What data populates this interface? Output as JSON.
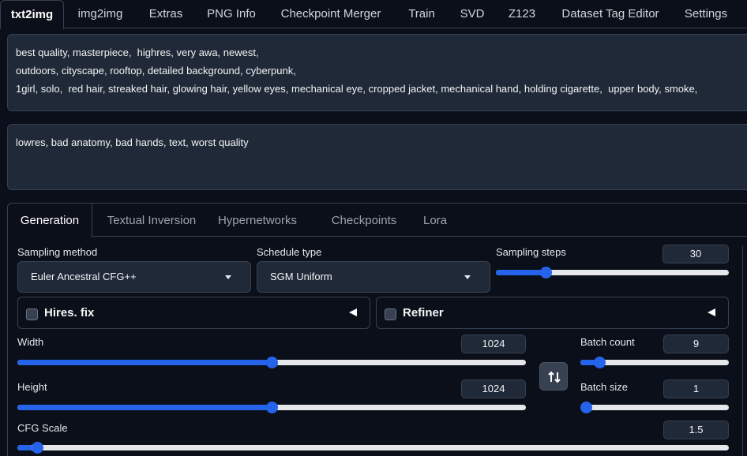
{
  "top_tabs": [
    {
      "label": "txt2img",
      "active": true
    },
    {
      "label": "img2img"
    },
    {
      "label": "Extras"
    },
    {
      "label": "PNG Info"
    },
    {
      "label": "Checkpoint Merger"
    },
    {
      "label": "Train"
    },
    {
      "label": "SVD"
    },
    {
      "label": "Z123"
    },
    {
      "label": "Dataset Tag Editor"
    },
    {
      "label": "Settings"
    }
  ],
  "prompt": {
    "positive": "best quality, masterpiece,  highres, very awa, newest,\noutdoors, cityscape, rooftop, detailed background, cyberpunk,\n1girl, solo,  red hair, streaked hair, glowing hair, yellow eyes, mechanical eye, cropped jacket, mechanical hand, holding cigarette,  upper body, smoke,",
    "negative": "lowres, bad anatomy, bad hands, text, worst quality"
  },
  "sub_tabs": [
    {
      "label": "Generation",
      "active": true
    },
    {
      "label": "Textual Inversion"
    },
    {
      "label": "Hypernetworks"
    },
    {
      "label": "Checkpoints"
    },
    {
      "label": "Lora"
    }
  ],
  "sampling_method": {
    "label": "Sampling method",
    "value": "Euler Ancestral CFG++"
  },
  "schedule_type": {
    "label": "Schedule type",
    "value": "SGM Uniform"
  },
  "sampling_steps": {
    "label": "Sampling steps",
    "value": "30",
    "fraction": 0.2
  },
  "hires_fix": {
    "label": "Hires. fix"
  },
  "refiner": {
    "label": "Refiner"
  },
  "width": {
    "label": "Width",
    "value": "1024",
    "fraction": 0.5
  },
  "height": {
    "label": "Height",
    "value": "1024",
    "fraction": 0.5
  },
  "batch_count": {
    "label": "Batch count",
    "value": "9",
    "fraction": 0.1
  },
  "batch_size": {
    "label": "Batch size",
    "value": "1",
    "fraction": 0.0
  },
  "cfg_scale": {
    "label": "CFG Scale",
    "value": "1.5",
    "fraction": 0.02
  },
  "colors": {
    "accent": "#2563eb",
    "background": "#0b0f19",
    "field": "#1f2937",
    "border": "#374151"
  },
  "icons": {
    "swap": "swap-vertical-icon",
    "dropdown": "chevron-down-icon",
    "accordion": "triangle-left-icon"
  }
}
